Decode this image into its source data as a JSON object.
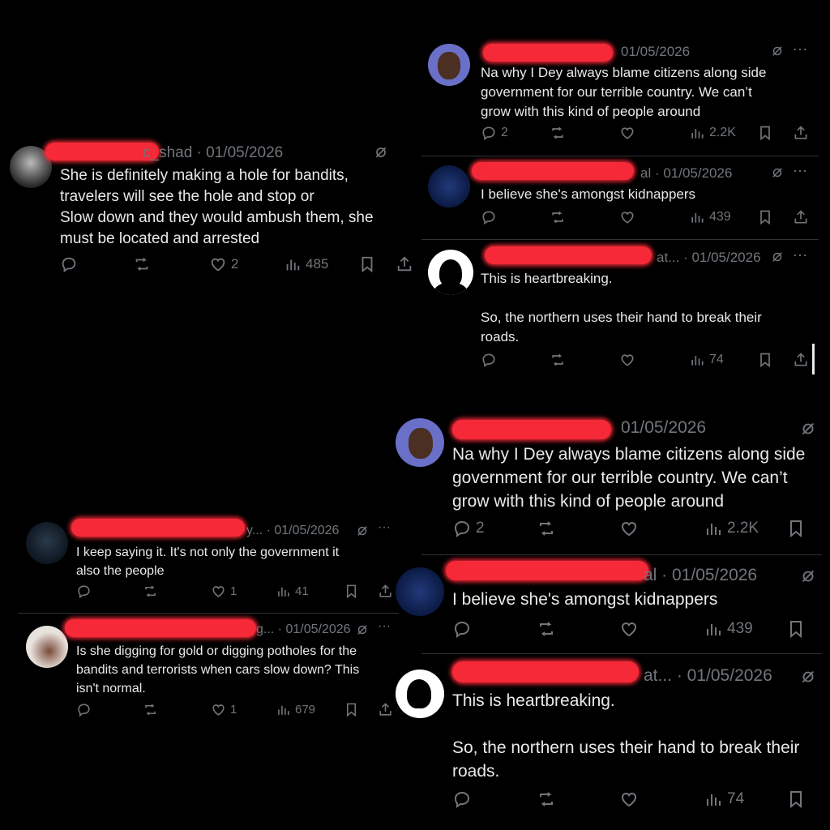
{
  "t1": {
    "date": "01/05/2026",
    "handle_tail": "c_shad · ",
    "text": "She is definitely making a hole for bandits,\ntravelers will see the hole and stop or\nSlow down and they would ambush them, she\nmust be located and arrested",
    "likes": "2",
    "views": "485"
  },
  "t2": {
    "date": "01/05/2026",
    "text": "Na why I Dey always blame citizens along side\ngovernment for our terrible country. We can’t\ngrow with this kind of people around",
    "replies": "2",
    "views": "2.2K"
  },
  "t3": {
    "date": "al · 01/05/2026",
    "text": "I believe she's amongst kidnappers",
    "views": "439"
  },
  "t4": {
    "date": "at... · 01/05/2026",
    "text": "This is heartbreaking.\n\nSo, the northern uses their hand to break their\nroads.",
    "views": "74"
  },
  "t5": {
    "date": "y... · 01/05/2026",
    "text": "I keep saying it. It's not only the government it\nalso the people",
    "likes": "1",
    "views": "41"
  },
  "t6": {
    "date": "g... · 01/05/2026",
    "text": "Is she digging for gold or digging potholes for the\nbandits and terrorists when cars slow down? This\nisn't normal.",
    "likes": "1",
    "views": "679"
  },
  "t7": {
    "date": "01/05/2026",
    "text": "Na why I Dey always blame citizens along side\ngovernment for our terrible country. We can’t\ngrow with this kind of people around",
    "replies": "2",
    "views": "2.2K"
  },
  "t8": {
    "date": "al · 01/05/2026",
    "text": "I believe she's amongst kidnappers",
    "views": "439"
  },
  "t9": {
    "date": "at... · 01/05/2026",
    "text": "This is heartbreaking.\n\nSo, the northern uses their hand to break their\nroads.",
    "views": "74"
  },
  "ui": {
    "more": "···",
    "grok_icon": "slash-circle-icon"
  }
}
